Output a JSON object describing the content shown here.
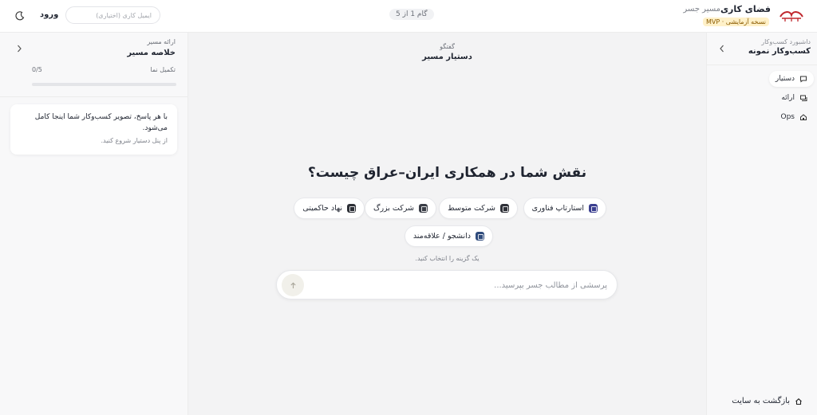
{
  "header": {
    "brand_title": "فضای کاری",
    "brand_subtitle": "مسیر جسر",
    "badge": "نسخه آزمایشی · MVP",
    "step_indicator": "گام 1 از 5",
    "email_placeholder": "ایمیل کاری (اختیاری)",
    "login_label": "ورود"
  },
  "sidebar": {
    "subtitle": "داشبورد کسب‌وکار",
    "title": "کسب‌وکار نمونه",
    "items": [
      {
        "label": "دستیار",
        "icon": "chat-icon",
        "active": true
      },
      {
        "label": "ارائه",
        "icon": "presentation-icon",
        "active": false
      },
      {
        "label": "Ops",
        "icon": "ops-icon",
        "active": false
      }
    ],
    "back_label": "بازگشت به سایت"
  },
  "left_panel": {
    "subtitle": "ارائه مسیر",
    "title": "خلاصه مسیر",
    "progress_label": "تکمیل نما",
    "progress_count": "0/5",
    "progress_value": 0,
    "card_text": "با هر پاسخ، تصویر کسب‌وکار شما اینجا کامل می‌شود.",
    "card_hint": "از پنل دستیار شروع کنید."
  },
  "main": {
    "subtitle": "گفتگو",
    "title": "دستیار مسیر",
    "question": "نقش شما در همکاری ایران–عراق چیست؟",
    "options": [
      {
        "label": "استارتاپ فناوری",
        "icon_color": "#3b3f8f"
      },
      {
        "label": "شرکت متوسط",
        "icon_color": "#2f3138"
      },
      {
        "label": "شرکت بزرگ",
        "icon_color": "#3a3d46"
      },
      {
        "label": "نهاد حاکمیتی",
        "icon_color": "#2c2f36"
      },
      {
        "label": "دانشجو / علاقه‌مند",
        "icon_color": "#2f4b7c"
      }
    ],
    "hint": "یک گزینه را انتخاب کنید.",
    "input_placeholder": "پرسشی از مطالب جسر بپرسید..."
  },
  "colors": {
    "brand_red": "#c0262d",
    "badge_bg": "#fff1c9",
    "main_bg": "#f3f3f4",
    "sidebar_bg": "#f8f8f9"
  }
}
